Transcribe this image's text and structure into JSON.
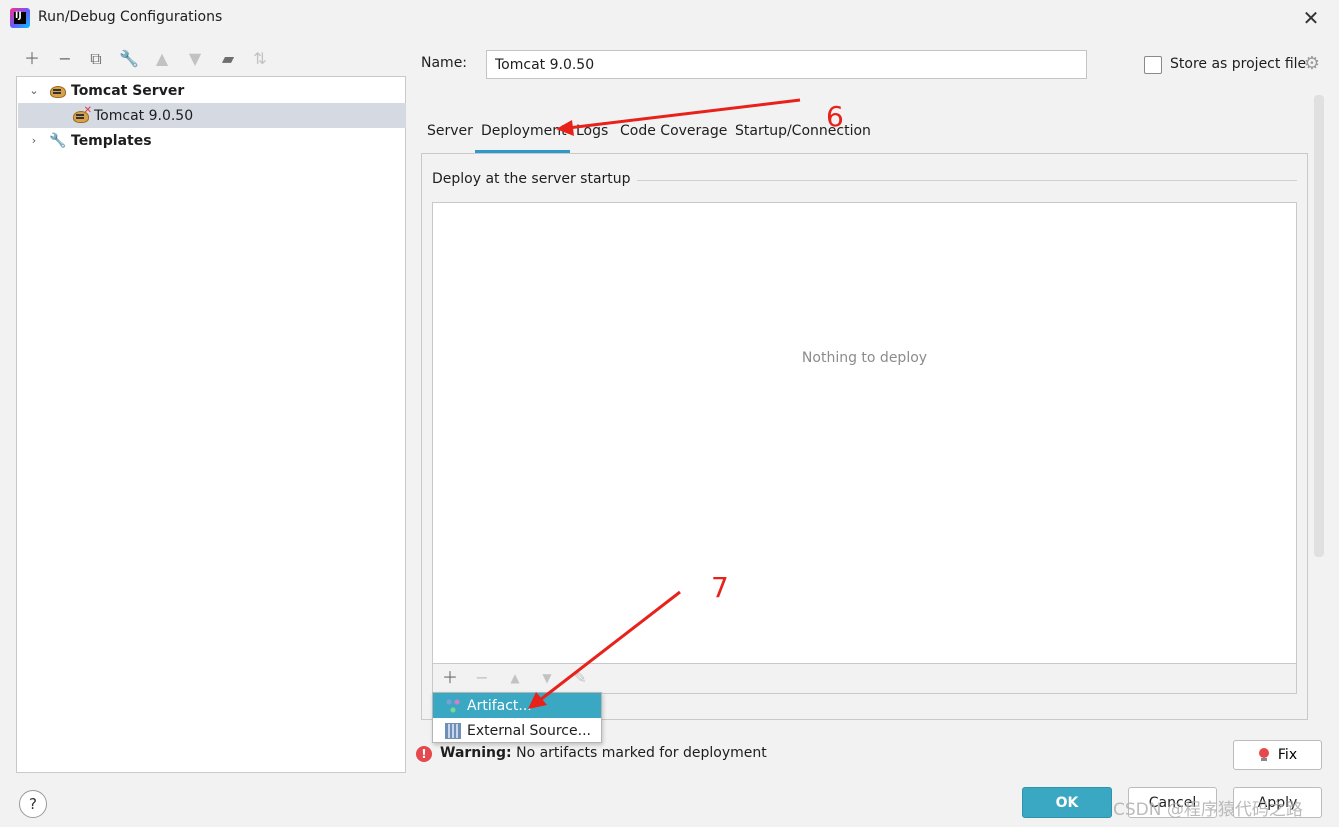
{
  "window": {
    "title": "Run/Debug Configurations",
    "app_icon_letters": "IJ"
  },
  "toolbar": {
    "icons": [
      "plus-icon",
      "minus-icon",
      "copy-icon",
      "wrench-icon",
      "arrow-up-icon",
      "arrow-down-icon",
      "folder-icon",
      "sort-icon"
    ]
  },
  "tree": {
    "items": [
      {
        "label": "Tomcat Server",
        "bold": true,
        "expanded": true
      },
      {
        "label": "Tomcat 9.0.50",
        "selected": true
      },
      {
        "label": "Templates",
        "bold": true,
        "expanded": false
      }
    ]
  },
  "config": {
    "name_label": "Name:",
    "name_value": "Tomcat 9.0.50",
    "store_label": "Store as project file",
    "store_checked": false
  },
  "tabs": [
    "Server",
    "Deployment",
    "Logs",
    "Code Coverage",
    "Startup/Connection"
  ],
  "active_tab": "Deployment",
  "deployment": {
    "section_title": "Deploy at the server startup",
    "empty_text": "Nothing to deploy",
    "popup": [
      {
        "label": "Artifact...",
        "highlighted": true
      },
      {
        "label": "External Source..."
      }
    ]
  },
  "warning": {
    "prefix": "Warning:",
    "text": " No artifacts marked for deployment"
  },
  "buttons": {
    "fix": "Fix",
    "ok": "OK",
    "cancel": "Cancel",
    "apply": "Apply",
    "help": "?"
  },
  "annotations": {
    "step6": "6",
    "step7": "7",
    "watermark": "CSDN @程序猿代码之路"
  },
  "colors": {
    "accent": "#3aa8c2",
    "tab_underline": "#2d9ac9",
    "annotation": "#e8211a",
    "error": "#e5484d"
  }
}
